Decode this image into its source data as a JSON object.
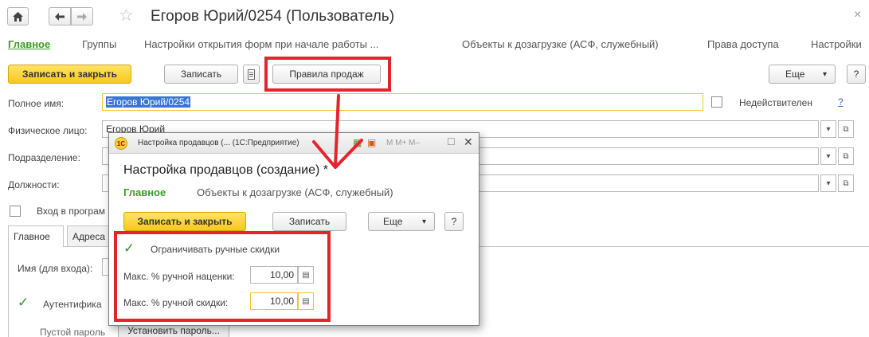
{
  "window": {
    "title": "Егоров Юрий/0254 (Пользователь)",
    "home_icon": "home-icon",
    "back_icon": "arrow-left-icon",
    "forward_icon": "arrow-right-icon",
    "star_icon": "star-icon",
    "close_glyph": "×"
  },
  "nav_tabs": [
    "Главное",
    "Группы",
    "Настройки открытия форм при начале работы ...",
    "Объекты к дозагрузке (АСФ, служебный)",
    "Права доступа",
    "Настройки"
  ],
  "toolbar": {
    "save_close": "Записать и закрыть",
    "save": "Записать",
    "sales_rules": "Правила продаж",
    "more": "Еще",
    "more_arrow": "▾",
    "help": "?"
  },
  "form": {
    "full_name_label": "Полное имя:",
    "full_name_value": "Егоров Юрий/0254",
    "inactive_label": "Недействителен",
    "inactive_help": "?",
    "person_label": "Физическое лицо:",
    "person_value": "Егоров Юрий",
    "department_label": "Подразделение:",
    "positions_label": "Должности:",
    "login_label": "Вход в програм",
    "login_name_label": "Имя (для входа):",
    "auth_label": "Аутентифика",
    "empty_password": "Пустой пароль",
    "set_password": "Установить пароль..."
  },
  "sub_tabs": [
    "Главное",
    "Адреса"
  ],
  "dialog": {
    "window_title": "Настройка продавцов (... (1С:Предприятие)",
    "toolbar_glyphs": "M  M+  M–",
    "heading": "Настройка продавцов (создание) *",
    "tabs": [
      "Главное",
      "Объекты к дозагрузке (АСФ, служебный)"
    ],
    "save_close": "Записать и закрыть",
    "save": "Записать",
    "more": "Еще",
    "help": "?",
    "limit_discounts_label": "Ограничивать ручные скидки",
    "max_markup_label": "Макс. % ручной наценки:",
    "max_markup_value": "10,00",
    "max_discount_label": "Макс. % ручной скидки:",
    "max_discount_value": "10,00"
  },
  "colors": {
    "accent_green": "#3a9d23",
    "yellow_button": "#f7c917",
    "annotation_red": "#e5232e",
    "selection_blue": "#3875d7"
  }
}
